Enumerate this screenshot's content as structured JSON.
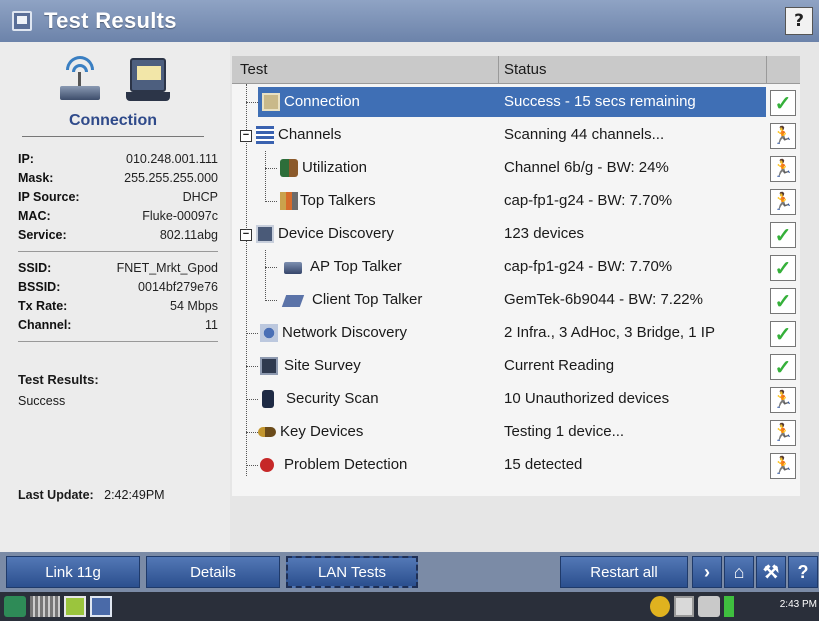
{
  "window": {
    "title": "Test Results",
    "help_label": "?"
  },
  "left_panel": {
    "connection_label": "Connection",
    "info1": [
      {
        "key": "IP:",
        "value": "010.248.001.111"
      },
      {
        "key": "Mask:",
        "value": "255.255.255.000"
      },
      {
        "key": "IP Source:",
        "value": "DHCP"
      },
      {
        "key": "MAC:",
        "value": "Fluke-00097c"
      },
      {
        "key": "Service:",
        "value": "802.11abg"
      }
    ],
    "info2": [
      {
        "key": "SSID:",
        "value": "FNET_Mrkt_Gpod"
      },
      {
        "key": "BSSID:",
        "value": "0014bf279e76"
      },
      {
        "key": "Tx Rate:",
        "value": "54 Mbps"
      },
      {
        "key": "Channel:",
        "value": "11"
      }
    ],
    "test_results_label": "Test Results:",
    "test_results_value": "Success",
    "last_update_label": "Last Update:",
    "last_update_value": "2:42:49PM"
  },
  "table": {
    "col_test": "Test",
    "col_status": "Status",
    "rows": [
      {
        "test": "Connection",
        "status": "Success - 15 secs remaining",
        "state": "ok",
        "icon": "connection-icon"
      },
      {
        "test": "Channels",
        "status": "Scanning 44 channels...",
        "state": "running",
        "icon": "channels-icon"
      },
      {
        "test": "Utilization",
        "status": "Channel 6b/g - BW: 24%",
        "state": "running",
        "icon": "utilization-icon"
      },
      {
        "test": "Top Talkers",
        "status": "cap-fp1-g24   - BW: 7.70%",
        "state": "running",
        "icon": "top-talkers-icon"
      },
      {
        "test": "Device Discovery",
        "status": "123 devices",
        "state": "ok",
        "icon": "device-discovery-icon"
      },
      {
        "test": "AP Top Talker",
        "status": "cap-fp1-g24   - BW: 7.70%",
        "state": "ok",
        "icon": "ap-icon"
      },
      {
        "test": "Client Top Talker",
        "status": "GemTek-6b9044 - BW: 7.22%",
        "state": "ok",
        "icon": "client-icon"
      },
      {
        "test": "Network Discovery",
        "status": "2 Infra., 3 AdHoc, 3 Bridge, 1 IP",
        "state": "ok",
        "icon": "network-discovery-icon"
      },
      {
        "test": "Site Survey",
        "status": "Current Reading",
        "state": "ok",
        "icon": "site-survey-icon"
      },
      {
        "test": "Security Scan",
        "status": "10 Unauthorized devices",
        "state": "running",
        "icon": "security-scan-icon"
      },
      {
        "test": "Key Devices",
        "status": "Testing 1 device...",
        "state": "running",
        "icon": "key-devices-icon"
      },
      {
        "test": "Problem Detection",
        "status": "15 detected",
        "state": "running",
        "icon": "problem-detection-icon"
      }
    ]
  },
  "toolbar": {
    "link": "Link 11g",
    "details": "Details",
    "lan_tests": "LAN Tests",
    "restart_all": "Restart all",
    "next": "›",
    "home": "⌂",
    "tools": "⚒",
    "help": "?"
  },
  "taskbar": {
    "clock": "2:43 PM"
  },
  "colors": {
    "selection": "#3f6fb5",
    "ok": "#35b03a",
    "toolbar": "#2b4f8e"
  }
}
